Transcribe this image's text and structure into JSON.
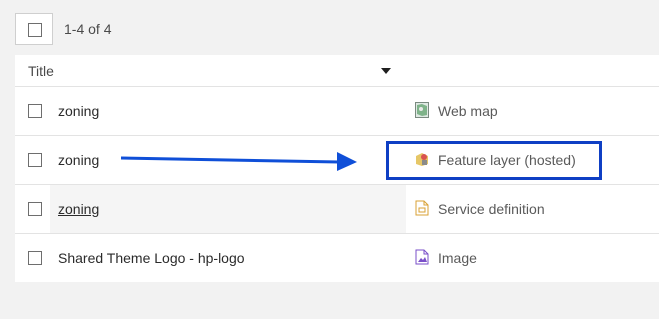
{
  "toolbar": {
    "count_text": "1-4 of 4"
  },
  "table": {
    "title_header": "Title",
    "rows": [
      {
        "name": "zoning",
        "type": "Web map",
        "icon": "web-map-icon"
      },
      {
        "name": "zoning",
        "type": "Feature layer (hosted)",
        "icon": "feature-layer-icon"
      },
      {
        "name": "zoning",
        "type": "Service definition",
        "icon": "service-definition-icon"
      },
      {
        "name": "Shared Theme Logo - hp-logo",
        "type": "Image",
        "icon": "image-icon"
      }
    ]
  },
  "annotation": {
    "arrow_color": "#0f4fd8",
    "highlight_color": "#0f3fc4"
  }
}
